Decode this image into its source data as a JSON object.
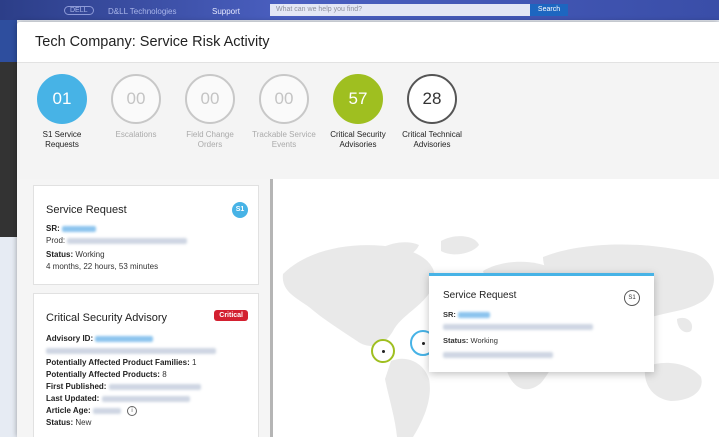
{
  "background_bar": {
    "brand": "D&LL Technologies",
    "support": "Support",
    "search_placeholder": "What can we help you find?",
    "search_button": "Search"
  },
  "modal": {
    "title": "Tech Company: Service Risk Activity"
  },
  "metrics": [
    {
      "value": "01",
      "label_line1": "S1 Service",
      "label_line2": "Requests",
      "style": "blue"
    },
    {
      "value": "00",
      "label_line1": "Escalations",
      "label_line2": "",
      "style": "muted"
    },
    {
      "value": "00",
      "label_line1": "Field Change",
      "label_line2": "Orders",
      "style": "muted"
    },
    {
      "value": "00",
      "label_line1": "Trackable Service",
      "label_line2": "Events",
      "style": "muted"
    },
    {
      "value": "57",
      "label_line1": "Critical Security",
      "label_line2": "Advisories",
      "style": "green"
    },
    {
      "value": "28",
      "label_line1": "Critical Technical",
      "label_line2": "Advisories",
      "style": "dark"
    }
  ],
  "service_request_card": {
    "title": "Service Request",
    "badge": "S1",
    "sr_label": "SR:",
    "prod_label": "Prod:",
    "status_label": "Status:",
    "status_value": "Working",
    "duration": "4 months, 22 hours, 53 minutes"
  },
  "advisory_card": {
    "title": "Critical Security Advisory",
    "badge": "Critical",
    "advisory_id_label": "Advisory ID:",
    "families_label": "Potentially Affected Product Families:",
    "families_value": "1",
    "products_label": "Potentially Affected Products:",
    "products_value": "8",
    "first_published_label": "First Published:",
    "last_updated_label": "Last Updated:",
    "article_age_label": "Article Age:",
    "status_label": "Status:",
    "status_value": "New"
  },
  "map_tooltip": {
    "title": "Service Request",
    "badge": "S1",
    "sr_label": "SR:",
    "status_label": "Status:",
    "status_value": "Working"
  },
  "colors": {
    "s1_blue": "#47b3e6",
    "security_green": "#9fbf20",
    "critical_red": "#d32030"
  }
}
